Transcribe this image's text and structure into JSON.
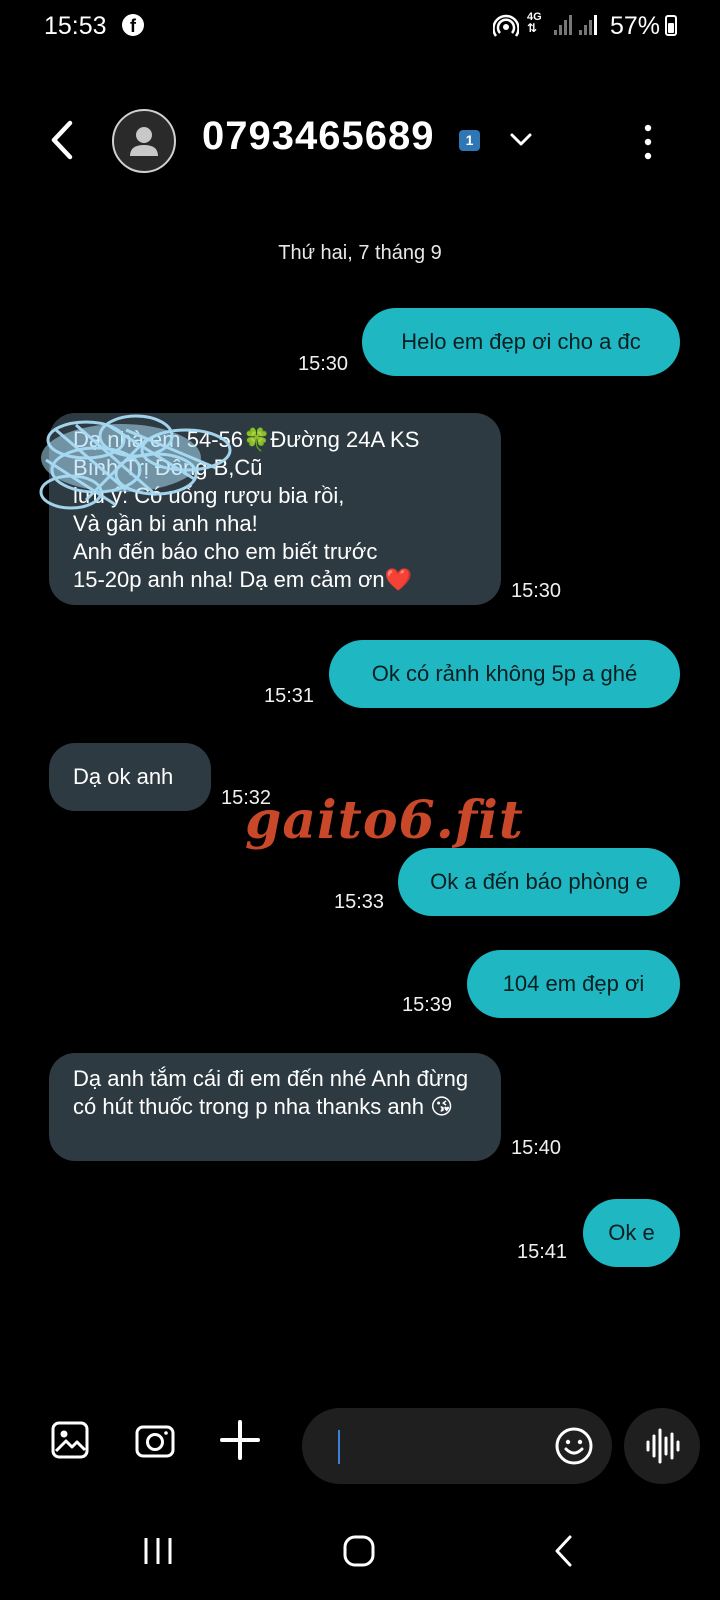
{
  "status_bar": {
    "time": "15:53",
    "network": "4G",
    "battery": "57%",
    "battery_level": 0.57,
    "icons": [
      "facebook-icon",
      "hotspot-icon",
      "signal-icon",
      "battery-icon"
    ]
  },
  "header": {
    "contact": "0793465689",
    "sim_badge": "1",
    "icons": [
      "back-icon",
      "avatar-icon",
      "chevron-down-icon",
      "more-vert-icon"
    ]
  },
  "conversation": {
    "date": "Thứ hai, 7 tháng 9",
    "messages": [
      {
        "dir": "sent",
        "text": "Helo em đẹp ơi cho a đc",
        "time": "15:30"
      },
      {
        "dir": "received",
        "text": "Dạ nhà em 54-56🍀Đường 24A KS\n Bình Trị Đông B,Cũ\n lưu ý: Có uống rượu bia rồi,\nVà gần bi anh nha!\nAnh đến báo cho em biết trước\n15-20p anh nha! Dạ em cảm ơn❤️",
        "time": "15:30"
      },
      {
        "dir": "sent",
        "text": "Ok có  rảnh không 5p a ghé",
        "time": "15:31"
      },
      {
        "dir": "received",
        "text": "Dạ ok anh",
        "time": "15:32"
      },
      {
        "dir": "sent",
        "text": "Ok a đến báo phòng e",
        "time": "15:33"
      },
      {
        "dir": "sent",
        "text": "104  em đẹp ơi",
        "time": "15:39"
      },
      {
        "dir": "received",
        "text": "Dạ anh tắm cái đi em đến nhé Anh đừng có hút thuốc trong p nha thanks anh 😘",
        "time": "15:40"
      },
      {
        "dir": "sent",
        "text": "Ok e",
        "time": "15:41"
      }
    ]
  },
  "watermark": "gaito6.fit",
  "composer": {
    "input_value": "",
    "icons": [
      "gallery-icon",
      "camera-icon",
      "plus-icon",
      "emoji-icon",
      "voice-icon"
    ]
  },
  "nav_bar": {
    "icons": [
      "recents-icon",
      "home-icon",
      "back-icon"
    ]
  },
  "colors": {
    "sent_bubble": "#1fb8c2",
    "received_bubble": "#2e3a42",
    "watermark": "#c9482a",
    "sim_badge": "#2f76b5"
  }
}
